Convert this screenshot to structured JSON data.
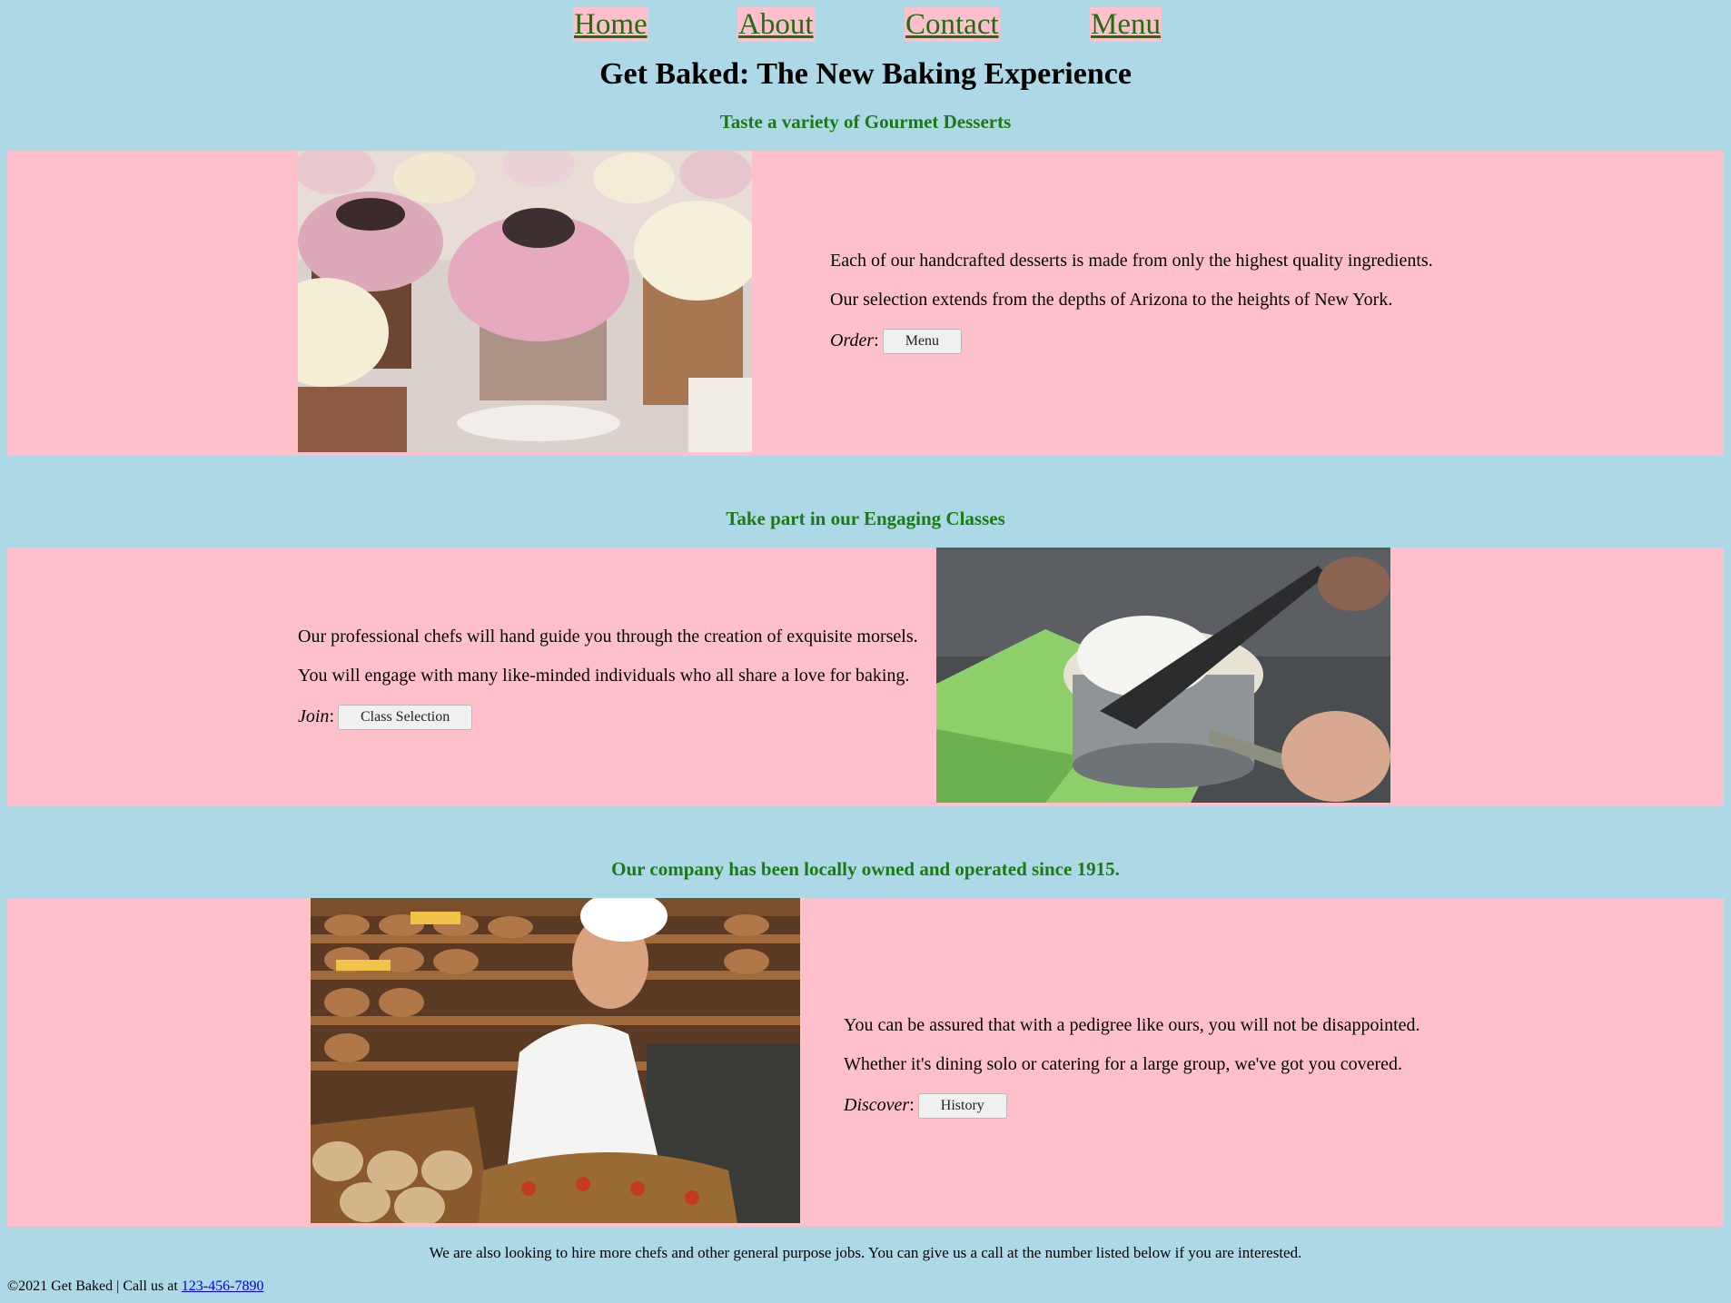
{
  "nav": {
    "items": [
      {
        "label": "Home"
      },
      {
        "label": "About"
      },
      {
        "label": "Contact"
      },
      {
        "label": "Menu"
      }
    ]
  },
  "page": {
    "title": "Get Baked: The New Baking Experience"
  },
  "sections": [
    {
      "heading": "Taste a variety of Gourmet Desserts",
      "lines": [
        "Each of our handcrafted desserts is made from only the highest quality ingredients.",
        "Our selection extends from the depths of Arizona to the heights of New York."
      ],
      "cta_label": "Order",
      "cta_separator": ":",
      "button_label": "Menu"
    },
    {
      "heading": "Take part in our Engaging Classes",
      "lines": [
        "Our professional chefs will hand guide you through the creation of exquisite morsels.",
        "You will engage with many like-minded individuals who all share a love for baking."
      ],
      "cta_label": "Join",
      "cta_separator": ":",
      "button_label": "Class Selection"
    },
    {
      "heading": "Our company has been locally owned and operated since 1915.",
      "lines": [
        "You can be assured that with a pedigree like ours, you will not be disappointed.",
        "Whether it's dining solo or catering for a large group, we've got you covered."
      ],
      "cta_label": "Discover",
      "cta_separator": ":",
      "button_label": "History"
    }
  ],
  "hiring_text": "We are also looking to hire more chefs and other general purpose jobs. You can give us a call at the number listed below if you are interested.",
  "footer": {
    "copyright": "©2021 Get Baked | Call us at ",
    "phone": "123-456-7890"
  },
  "colors": {
    "background": "#ADD8E6",
    "panel": "#FFC0CB",
    "nav_link": "#1f6e14",
    "section_heading": "#1a7a14",
    "footer_link": "#0000EE"
  }
}
